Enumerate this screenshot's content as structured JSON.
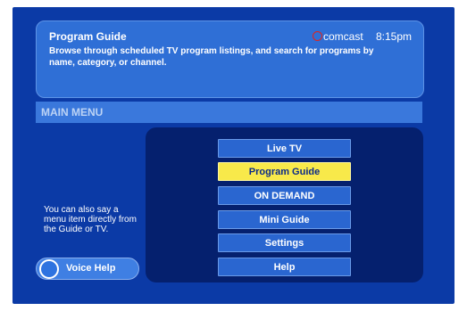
{
  "header": {
    "title": "Program Guide",
    "description": "Browse through scheduled TV program listings, and search for programs by name, category, or channel.",
    "brand": "comcast",
    "brand_icon": "comcast-logo-icon",
    "time": "8:15pm"
  },
  "menu": {
    "section_label": "MAIN MENU",
    "items": [
      {
        "label": "Live TV",
        "selected": false
      },
      {
        "label": "Program Guide",
        "selected": true
      },
      {
        "label": "ON DEMAND",
        "selected": false
      },
      {
        "label": "Mini Guide",
        "selected": false
      },
      {
        "label": "Settings",
        "selected": false
      },
      {
        "label": "Help",
        "selected": false
      }
    ]
  },
  "hint": {
    "text": "You can also say a menu item directly from the Guide or TV."
  },
  "voice": {
    "label": "Voice Help",
    "icon": "microphone-circle-icon"
  },
  "colors": {
    "background": "#0b3aa6",
    "panel": "#2f6fd6",
    "highlight": "#f8e94a",
    "brand_accent": "#e2231a"
  }
}
